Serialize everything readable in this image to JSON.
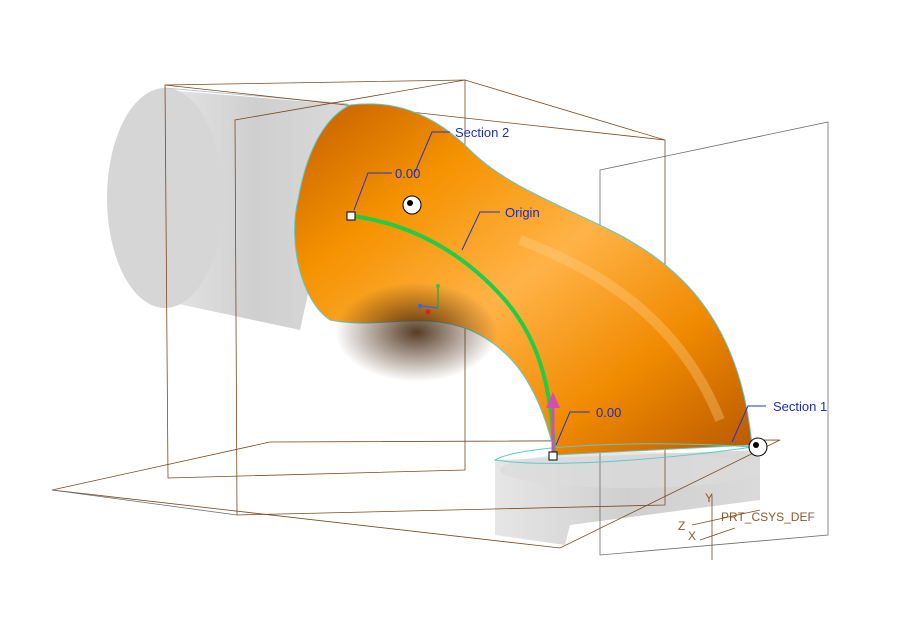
{
  "sections": {
    "section1_label": "Section 1",
    "section2_label": "Section 2"
  },
  "trajectory": {
    "origin_label": "Origin"
  },
  "dimensions": {
    "start_value": "0.00",
    "end_value": "0.00"
  },
  "csys": {
    "name": "PRT_CSYS_DEF",
    "axis_x": "X",
    "axis_y": "Y",
    "axis_z": "Z"
  },
  "colors": {
    "surface": "#f08a00",
    "surface_highlight": "#ffc55a",
    "surface_shadow": "#7a3d00",
    "trajectory": "#22cc44",
    "annotation": "#1d2dbb",
    "datum_plane": "#7a4a1e",
    "ghost_geometry": "#d4d4d4"
  }
}
